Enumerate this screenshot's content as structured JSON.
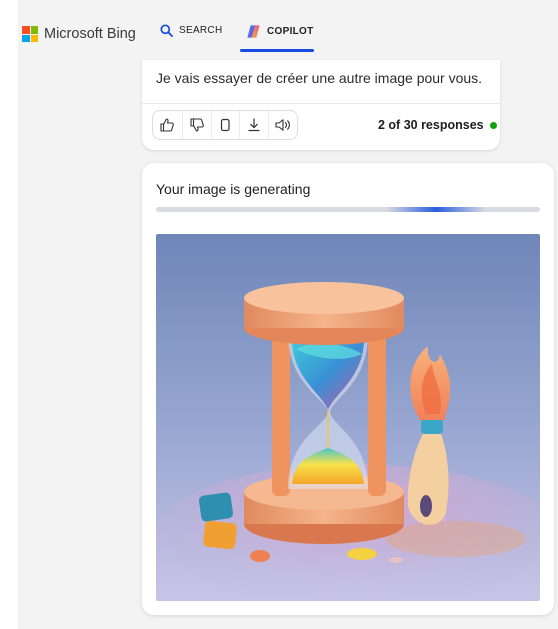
{
  "brand": {
    "name": "Microsoft Bing",
    "colors": [
      "#f25022",
      "#7fba00",
      "#00a4ef",
      "#ffb900"
    ]
  },
  "nav": {
    "search_label": "SEARCH",
    "copilot_label": "COPILOT",
    "active": "COPILOT",
    "accent": "#174ae4"
  },
  "message": {
    "text": "Je vais essayer de créer une autre image pour vous.",
    "actions": [
      "like-icon",
      "dislike-icon",
      "copy-icon",
      "download-icon",
      "read-aloud-icon"
    ],
    "responses_label": "2 of 30 responses",
    "status_color": "#13a10e"
  },
  "generation": {
    "title": "Your image is generating",
    "progress_shimmer": {
      "start": 0.6,
      "end": 0.86
    },
    "image_alt_icon": "hourglass-and-paintbrush-image"
  }
}
